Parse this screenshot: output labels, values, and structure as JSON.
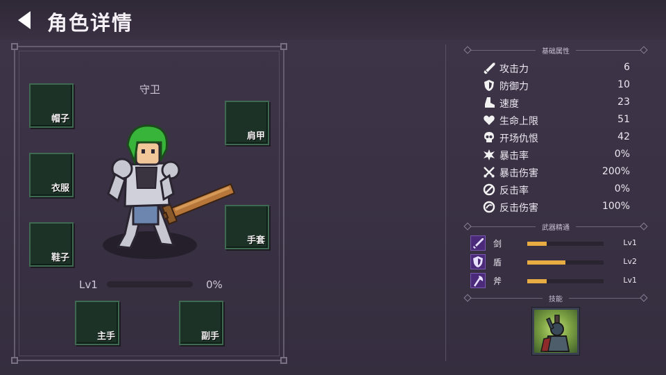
{
  "header": {
    "title": "角色详情",
    "back_icon": "back-arrow-icon"
  },
  "equipment": {
    "character_name": "守卫",
    "slots": {
      "hat": "帽子",
      "clothes": "衣服",
      "shoes": "鞋子",
      "shoulder": "肩甲",
      "gloves": "手套",
      "main_hand": "主手",
      "off_hand": "副手"
    },
    "level_label": "Lv1",
    "xp_fraction": 0,
    "xp_percent_text": "0%"
  },
  "stats": {
    "section_title": "基础属性",
    "items": [
      {
        "label": "攻击力",
        "value": "6",
        "icon": "sword-icon"
      },
      {
        "label": "防御力",
        "value": "10",
        "icon": "shield-icon"
      },
      {
        "label": "速度",
        "value": "23",
        "icon": "boot-icon"
      },
      {
        "label": "生命上限",
        "value": "51",
        "icon": "heart-icon"
      },
      {
        "label": "开场仇恨",
        "value": "42",
        "icon": "skull-icon"
      },
      {
        "label": "暴击率",
        "value": "0%",
        "icon": "crit-burst-icon"
      },
      {
        "label": "暴击伤害",
        "value": "200%",
        "icon": "crossed-swords-icon"
      },
      {
        "label": "反击率",
        "value": "0%",
        "icon": "counter-icon"
      },
      {
        "label": "反击伤害",
        "value": "100%",
        "icon": "counter-damage-icon"
      }
    ]
  },
  "mastery": {
    "section_title": "武器精通",
    "items": [
      {
        "label": "剑",
        "level": "Lv1",
        "progress": 0.25,
        "icon": "sword-mastery-icon"
      },
      {
        "label": "盾",
        "level": "Lv2",
        "progress": 0.5,
        "icon": "shield-mastery-icon"
      },
      {
        "label": "斧",
        "level": "Lv1",
        "progress": 0.25,
        "icon": "axe-mastery-icon"
      }
    ]
  },
  "skills": {
    "section_title": "技能",
    "items": [
      {
        "icon": "warrior-rally-skill-icon"
      }
    ]
  },
  "colors": {
    "accent_bar": "#e8ad42",
    "slot_bg": "#1c3226",
    "slot_border": "#3f6a52",
    "mastery_icon_bg": "#4b2a7a"
  }
}
